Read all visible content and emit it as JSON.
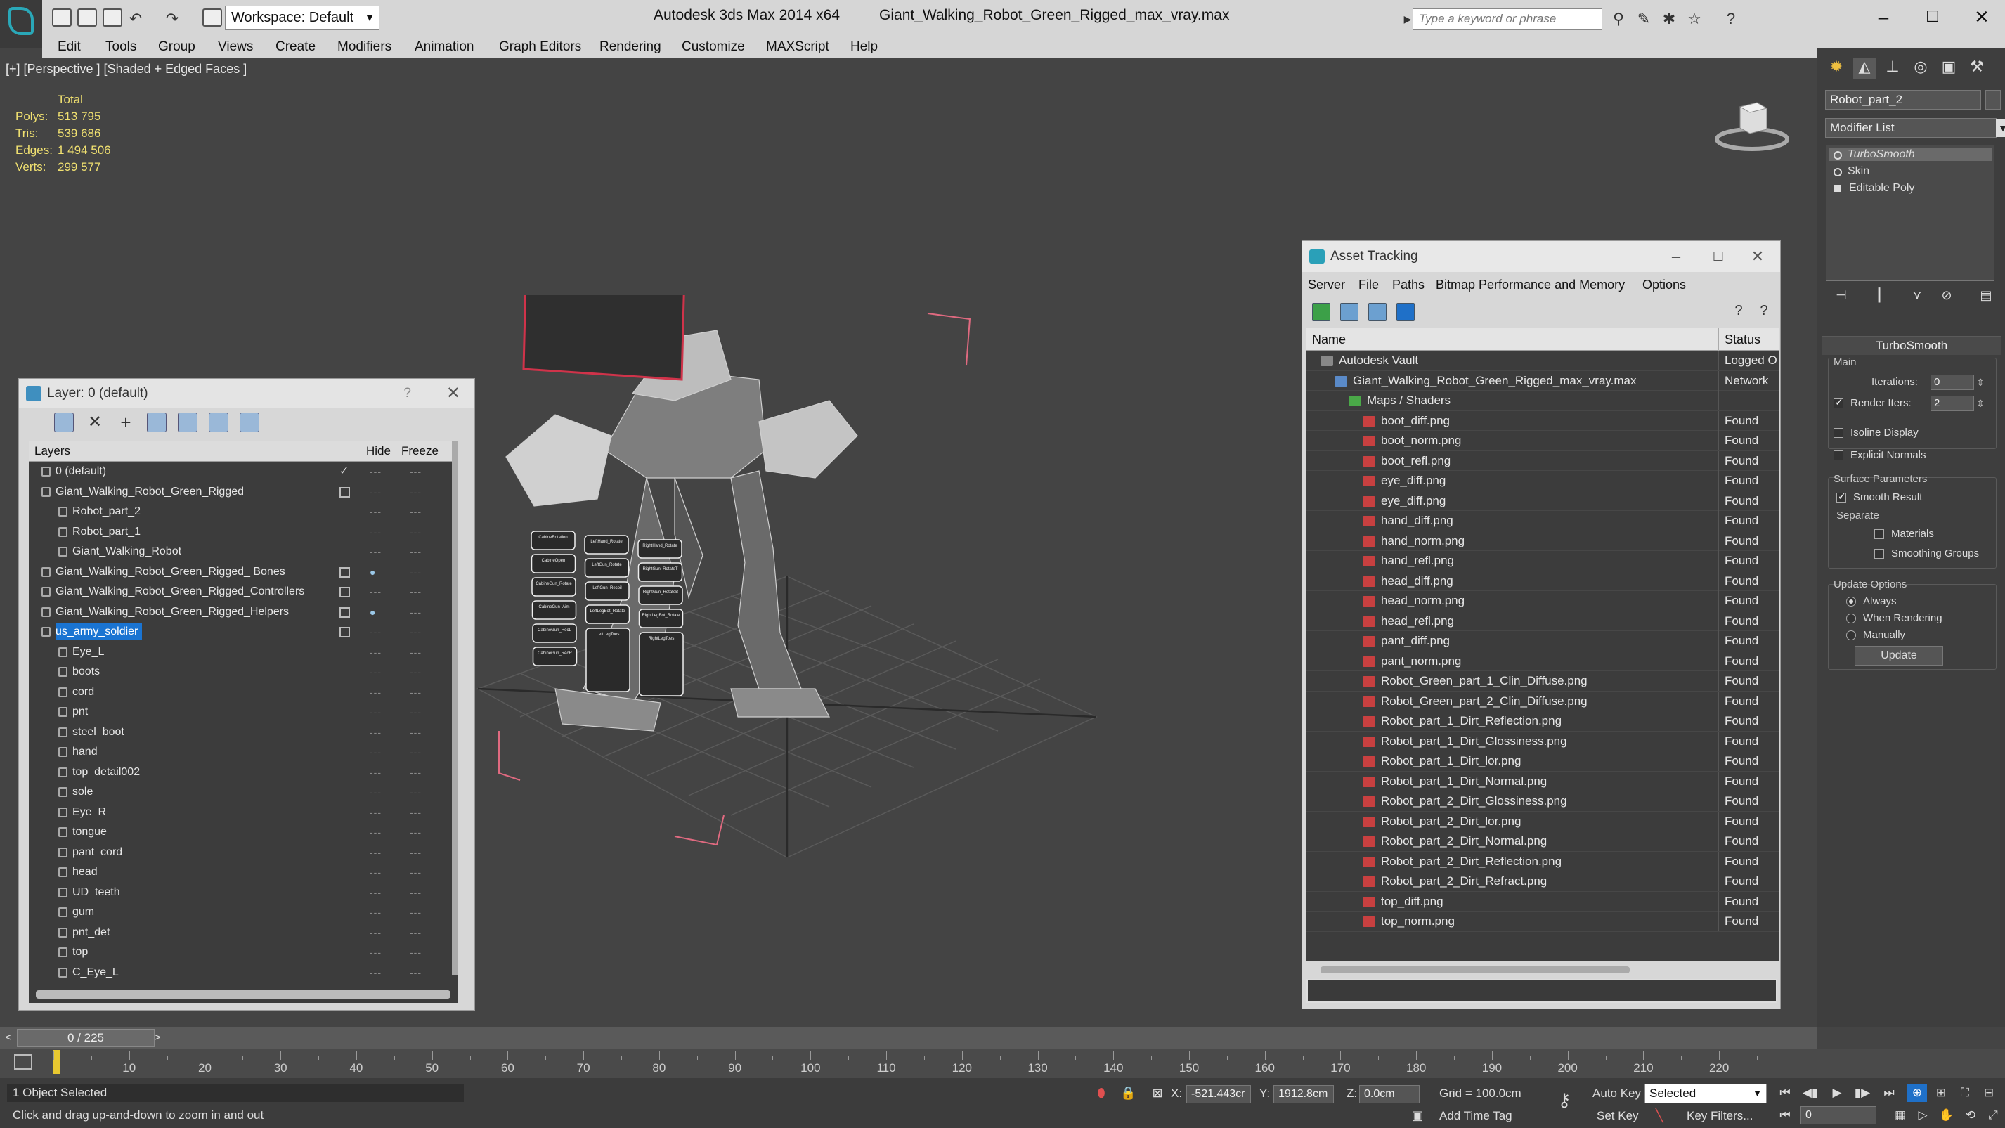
{
  "app": {
    "workspace": "Workspace: Default",
    "app_title": "Autodesk 3ds Max  2014 x64",
    "file_title": "Giant_Walking_Robot_Green_Rigged_max_vray.max",
    "search_placeholder": "Type a keyword or phrase"
  },
  "menu": [
    "Edit",
    "Tools",
    "Group",
    "Views",
    "Create",
    "Modifiers",
    "Animation",
    "Graph Editors",
    "Rendering",
    "Customize",
    "MAXScript",
    "Help"
  ],
  "viewport": {
    "label": "[+] [Perspective ] [Shaded + Edged Faces ]",
    "stats": {
      "total": "Total",
      "rows": [
        {
          "k": "Polys:",
          "v": "513 795"
        },
        {
          "k": "Tris:",
          "v": "539 686"
        },
        {
          "k": "Edges:",
          "v": "1 494 506"
        },
        {
          "k": "Verts:",
          "v": "299 577"
        }
      ]
    },
    "controls": {
      "col1": [
        "CabineRotation",
        "CabineOpen",
        "CabineGun_Rotate",
        "CabineGun_Aim",
        "CabineGun_RecL",
        "CabineGun_RecR"
      ],
      "col2": [
        "LeftHand_Rotate",
        "LeftGun_Rotate",
        "LeftGun_Recoil",
        "LeftLegBot_Rotate",
        "LeftLegToes"
      ],
      "col3": [
        "RightHand_Rotate",
        "RightGun_RotateT",
        "RightGun_RotateB",
        "RightLegBot_Rotate",
        "RightLegToes"
      ]
    }
  },
  "layer_panel": {
    "title": "Layer: 0 (default)",
    "help": "?",
    "columns": {
      "layers": "Layers",
      "hide": "Hide",
      "freeze": "Freeze"
    },
    "rows": [
      {
        "label": "0 (default)",
        "indent": 0,
        "type": "layer",
        "current": true
      },
      {
        "label": "Giant_Walking_Robot_Green_Rigged",
        "indent": 0,
        "type": "layer"
      },
      {
        "label": "Robot_part_2",
        "indent": 1,
        "type": "object"
      },
      {
        "label": "Robot_part_1",
        "indent": 1,
        "type": "object"
      },
      {
        "label": "Giant_Walking_Robot",
        "indent": 1,
        "type": "object"
      },
      {
        "label": "Giant_Walking_Robot_Green_Rigged_ Bones",
        "indent": 0,
        "type": "layer",
        "hidden": true
      },
      {
        "label": "Giant_Walking_Robot_Green_Rigged_Controllers",
        "indent": 0,
        "type": "layer"
      },
      {
        "label": "Giant_Walking_Robot_Green_Rigged_Helpers",
        "indent": 0,
        "type": "layer",
        "hidden": true
      },
      {
        "label": "us_army_soldier",
        "indent": 0,
        "type": "layer",
        "selected": true
      },
      {
        "label": "Eye_L",
        "indent": 1,
        "type": "object"
      },
      {
        "label": "boots",
        "indent": 1,
        "type": "object"
      },
      {
        "label": "cord",
        "indent": 1,
        "type": "object"
      },
      {
        "label": "pnt",
        "indent": 1,
        "type": "object"
      },
      {
        "label": "steel_boot",
        "indent": 1,
        "type": "object"
      },
      {
        "label": "hand",
        "indent": 1,
        "type": "object"
      },
      {
        "label": "top_detail002",
        "indent": 1,
        "type": "object"
      },
      {
        "label": "sole",
        "indent": 1,
        "type": "object"
      },
      {
        "label": "Eye_R",
        "indent": 1,
        "type": "object"
      },
      {
        "label": "tongue",
        "indent": 1,
        "type": "object"
      },
      {
        "label": "pant_cord",
        "indent": 1,
        "type": "object"
      },
      {
        "label": "head",
        "indent": 1,
        "type": "object"
      },
      {
        "label": "UD_teeth",
        "indent": 1,
        "type": "object"
      },
      {
        "label": "gum",
        "indent": 1,
        "type": "object"
      },
      {
        "label": "pnt_det",
        "indent": 1,
        "type": "object"
      },
      {
        "label": "top",
        "indent": 1,
        "type": "object"
      },
      {
        "label": "C_Eye_L",
        "indent": 1,
        "type": "object"
      }
    ]
  },
  "asset_panel": {
    "title": "Asset Tracking",
    "menu": [
      "Server",
      "File",
      "Paths",
      "Bitmap Performance and Memory",
      "Options"
    ],
    "columns": {
      "name": "Name",
      "status": "Status"
    },
    "rows": [
      {
        "name": "Autodesk Vault",
        "status": "Logged O",
        "indent": 0,
        "kind": "vault"
      },
      {
        "name": "Giant_Walking_Robot_Green_Rigged_max_vray.max",
        "status": "Network",
        "indent": 1,
        "kind": "file"
      },
      {
        "name": "Maps / Shaders",
        "status": "",
        "indent": 2,
        "kind": "folder"
      },
      {
        "name": "boot_diff.png",
        "status": "Found",
        "indent": 3,
        "kind": "png"
      },
      {
        "name": "boot_norm.png",
        "status": "Found",
        "indent": 3,
        "kind": "png"
      },
      {
        "name": "boot_refl.png",
        "status": "Found",
        "indent": 3,
        "kind": "png"
      },
      {
        "name": "eye_diff.png",
        "status": "Found",
        "indent": 3,
        "kind": "png"
      },
      {
        "name": "eye_diff.png",
        "status": "Found",
        "indent": 3,
        "kind": "png"
      },
      {
        "name": "hand_diff.png",
        "status": "Found",
        "indent": 3,
        "kind": "png"
      },
      {
        "name": "hand_norm.png",
        "status": "Found",
        "indent": 3,
        "kind": "png"
      },
      {
        "name": "hand_refl.png",
        "status": "Found",
        "indent": 3,
        "kind": "png"
      },
      {
        "name": "head_diff.png",
        "status": "Found",
        "indent": 3,
        "kind": "png"
      },
      {
        "name": "head_norm.png",
        "status": "Found",
        "indent": 3,
        "kind": "png"
      },
      {
        "name": "head_refl.png",
        "status": "Found",
        "indent": 3,
        "kind": "png"
      },
      {
        "name": "pant_diff.png",
        "status": "Found",
        "indent": 3,
        "kind": "png"
      },
      {
        "name": "pant_norm.png",
        "status": "Found",
        "indent": 3,
        "kind": "png"
      },
      {
        "name": "Robot_Green_part_1_Clin_Diffuse.png",
        "status": "Found",
        "indent": 3,
        "kind": "png"
      },
      {
        "name": "Robot_Green_part_2_Clin_Diffuse.png",
        "status": "Found",
        "indent": 3,
        "kind": "png"
      },
      {
        "name": "Robot_part_1_Dirt_Reflection.png",
        "status": "Found",
        "indent": 3,
        "kind": "png"
      },
      {
        "name": "Robot_part_1_Dirt_Glossiness.png",
        "status": "Found",
        "indent": 3,
        "kind": "png"
      },
      {
        "name": "Robot_part_1_Dirt_lor.png",
        "status": "Found",
        "indent": 3,
        "kind": "png"
      },
      {
        "name": "Robot_part_1_Dirt_Normal.png",
        "status": "Found",
        "indent": 3,
        "kind": "png"
      },
      {
        "name": "Robot_part_2_Dirt_Glossiness.png",
        "status": "Found",
        "indent": 3,
        "kind": "png"
      },
      {
        "name": "Robot_part_2_Dirt_lor.png",
        "status": "Found",
        "indent": 3,
        "kind": "png"
      },
      {
        "name": "Robot_part_2_Dirt_Normal.png",
        "status": "Found",
        "indent": 3,
        "kind": "png"
      },
      {
        "name": "Robot_part_2_Dirt_Reflection.png",
        "status": "Found",
        "indent": 3,
        "kind": "png"
      },
      {
        "name": "Robot_part_2_Dirt_Refract.png",
        "status": "Found",
        "indent": 3,
        "kind": "png"
      },
      {
        "name": "top_diff.png",
        "status": "Found",
        "indent": 3,
        "kind": "png"
      },
      {
        "name": "top_norm.png",
        "status": "Found",
        "indent": 3,
        "kind": "png"
      }
    ]
  },
  "command_panel": {
    "object_name": "Robot_part_2",
    "modifier_list": "Modifier List",
    "stack": [
      "TurboSmooth",
      "Skin",
      "Editable Poly"
    ],
    "rollout": {
      "title": "TurboSmooth",
      "main": "Main",
      "iterations_label": "Iterations:",
      "iterations": "0",
      "render_iters_label": "Render Iters:",
      "render_iters": "2",
      "isoline": "Isoline Display",
      "explicit": "Explicit Normals",
      "surface": "Surface Parameters",
      "smooth_result": "Smooth Result",
      "separate": "Separate",
      "materials": "Materials",
      "smoothing_groups": "Smoothing Groups",
      "update_options": "Update Options",
      "always": "Always",
      "when_rendering": "When Rendering",
      "manually": "Manually",
      "update": "Update"
    }
  },
  "timeline": {
    "position": "0 / 225",
    "ticks": [
      "10",
      "20",
      "30",
      "40",
      "50",
      "60",
      "70",
      "80",
      "90",
      "100",
      "110",
      "120",
      "130",
      "140",
      "150",
      "160",
      "170",
      "180",
      "190",
      "200",
      "210",
      "220"
    ]
  },
  "status": {
    "selected": "1 Object Selected",
    "prompt": "Click and drag up-and-down to zoom in and out",
    "x_label": "X:",
    "x": "-521.443cr",
    "y_label": "Y:",
    "y": "1912.8cm",
    "z_label": "Z:",
    "z": "0.0cm",
    "grid": "Grid = 100.0cm",
    "add_time_tag": "Add Time Tag",
    "auto_key": "Auto Key",
    "set_key": "Set Key",
    "selected_dd": "Selected",
    "key_filters": "Key Filters...",
    "frame": "0"
  }
}
